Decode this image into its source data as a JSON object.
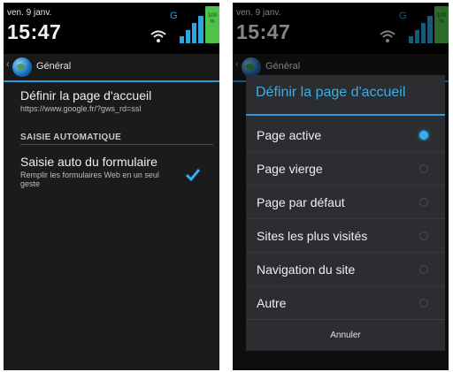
{
  "status": {
    "date": "ven. 9 janv.",
    "time": "15:47",
    "network": "G",
    "battery": "100 %"
  },
  "actionbar": {
    "title": "Général"
  },
  "prefs": {
    "homepage": {
      "title": "Définir la page d'accueil",
      "summary": "https://www.google.fr/?gws_rd=ssl"
    },
    "category": "SAISIE AUTOMATIQUE",
    "autofill": {
      "title": "Saisie auto du formulaire",
      "summary_line1": "Remplir les formulaires Web en un seul",
      "summary_line2": "geste",
      "checked": true
    }
  },
  "dialog": {
    "title": "Définir la page d'accueil",
    "options": [
      {
        "label": "Page active",
        "selected": true
      },
      {
        "label": "Page vierge",
        "selected": false
      },
      {
        "label": "Page par défaut",
        "selected": false
      },
      {
        "label": "Sites les plus visités",
        "selected": false
      },
      {
        "label": "Navigation du site",
        "selected": false
      },
      {
        "label": "Autre",
        "selected": false
      }
    ],
    "cancel": "Annuler"
  },
  "colors": {
    "accent": "#2a9bd6",
    "background": "#1b1b1d",
    "battery": "#4fc24a"
  }
}
